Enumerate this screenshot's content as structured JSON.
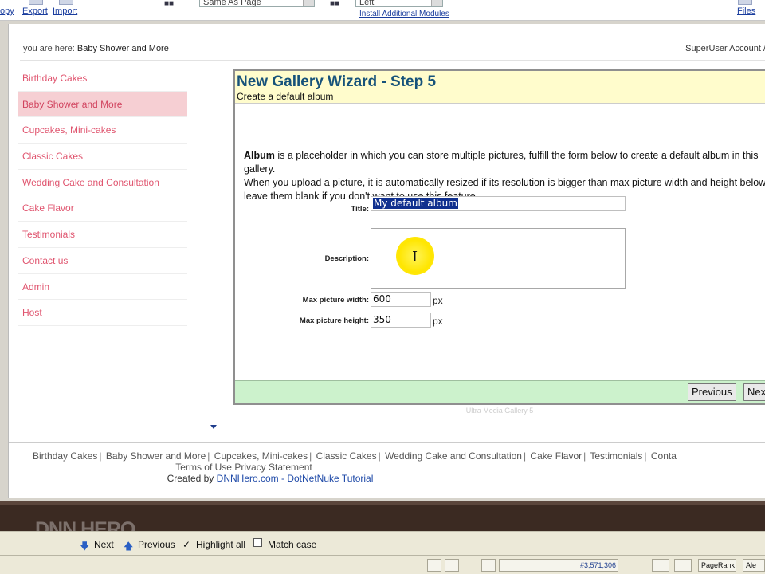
{
  "toolbar": {
    "copy": "opy",
    "export": "Export",
    "import": "Import",
    "page_select": "Same As Page",
    "pane_select": "Left",
    "install_modules": "Install Additional Modules",
    "files": "Files"
  },
  "breadcrumb": {
    "prefix": "you are here:",
    "current": "Baby Shower and More",
    "account": "SuperUser Account /"
  },
  "nav": {
    "items": [
      "Birthday Cakes",
      "Baby Shower and More",
      "Cupcakes, Mini-cakes",
      "Classic Cakes",
      "Wedding Cake and Consultation",
      "Cake Flavor",
      "Testimonials",
      "Contact us",
      "Admin",
      "Host"
    ],
    "active_index": 1
  },
  "wizard": {
    "title": "New Gallery Wizard - Step 5",
    "subtitle": "Create a default album",
    "desc_bold": "Album",
    "desc_1": " is a placeholder in which you can store multiple pictures, fulfill the form below to create a default album in this gallery.",
    "desc_2": "When you upload a picture, it is automatically resized if its resolution is bigger than max picture width and height below, leave them blank if you don't want to use this feature.",
    "title_label": "Title:",
    "title_value": "My default album",
    "description_label": "Description:",
    "max_width_label": "Max picture width:",
    "max_width_value": "600",
    "max_height_label": "Max picture height:",
    "max_height_value": "350",
    "unit": "px",
    "previous_button": "Previous",
    "next_button": "Nex",
    "module_credit": "Ultra Media Gallery 5"
  },
  "footer": {
    "links": [
      "Birthday Cakes",
      "Baby Shower and More",
      "Cupcakes, Mini-cakes",
      "Classic Cakes",
      "Wedding Cake and Consultation",
      "Cake Flavor",
      "Testimonials",
      "Conta"
    ],
    "terms": "Terms of Use",
    "privacy": "Privacy Statement",
    "created_by": "Created by",
    "created_link": "DNNHero.com - DotNetNuke Tutorial"
  },
  "findbar": {
    "next": "Next",
    "previous": "Previous",
    "highlight": "Highlight all",
    "match_case": "Match case"
  },
  "statusbar": {
    "rank": "#3,571,306",
    "pagerank": "PageRank",
    "ale": "Ale"
  },
  "logo": "DNN HERO",
  "colors": {
    "nav_link": "#e0556f",
    "nav_active_bg": "#f6cfd3",
    "wizard_header_bg": "#fffccc",
    "wizard_title": "#16527a",
    "wizard_footer_bg": "#ccf2cc",
    "selection": "#10308f"
  }
}
